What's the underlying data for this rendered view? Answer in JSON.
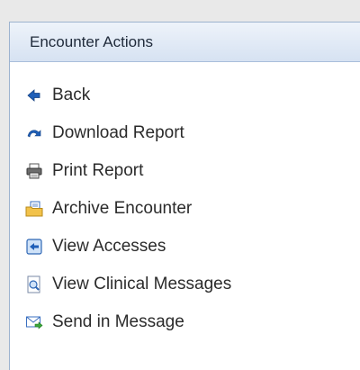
{
  "panel": {
    "title": "Encounter Actions",
    "items": [
      {
        "label": "Back",
        "icon": "back-arrow-icon"
      },
      {
        "label": "Download Report",
        "icon": "download-arrow-icon"
      },
      {
        "label": "Print Report",
        "icon": "printer-icon"
      },
      {
        "label": "Archive Encounter",
        "icon": "archive-folder-icon"
      },
      {
        "label": "View Accesses",
        "icon": "view-accesses-icon"
      },
      {
        "label": "View Clinical Messages",
        "icon": "document-magnifier-icon"
      },
      {
        "label": "Send in Message",
        "icon": "mail-send-icon"
      }
    ]
  },
  "colors": {
    "header_text": "#1f2a3a",
    "icon_blue": "#1f5fb8",
    "folder_yellow": "#f2c24a",
    "mail_green": "#3aa63a"
  }
}
